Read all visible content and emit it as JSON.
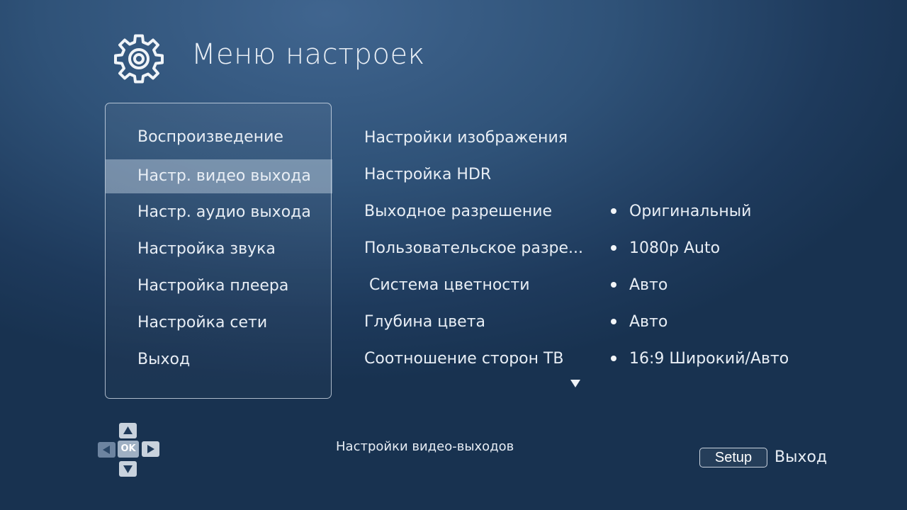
{
  "header": {
    "icon": "gear-icon",
    "title": "Меню настроек"
  },
  "menu": {
    "items": [
      {
        "label": "Воспроизведение"
      },
      {
        "label": "Настр. видео выхода",
        "selected": true
      },
      {
        "label": "Настр. аудио выхода"
      },
      {
        "label": "Настройка звука"
      },
      {
        "label": "Настройка плеера"
      },
      {
        "label": "Настройка сети"
      },
      {
        "label": "Выход"
      }
    ]
  },
  "options": [
    {
      "label": "Настройки изображения",
      "value": ""
    },
    {
      "label": "Настройка HDR",
      "value": ""
    },
    {
      "label": "Выходное разрешение",
      "value": "Оригинальный"
    },
    {
      "label": "Пользовательское разре...",
      "value": "1080p Auto"
    },
    {
      "label": " Система цветности",
      "value": "Авто"
    },
    {
      "label": "Глубина цвета",
      "value": "Авто"
    },
    {
      "label": "Соотношение сторон ТВ",
      "value": "16:9 Широкий/Авто"
    }
  ],
  "footer": {
    "dpad_ok": "OK",
    "hint": "Настройки видео-выходов",
    "setup_button": "Setup",
    "exit_label": "Выход"
  },
  "colors": {
    "background_top": "#40658f",
    "background_bottom": "#183250",
    "selection": "#8ea3bb",
    "text": "#e8eef5"
  }
}
